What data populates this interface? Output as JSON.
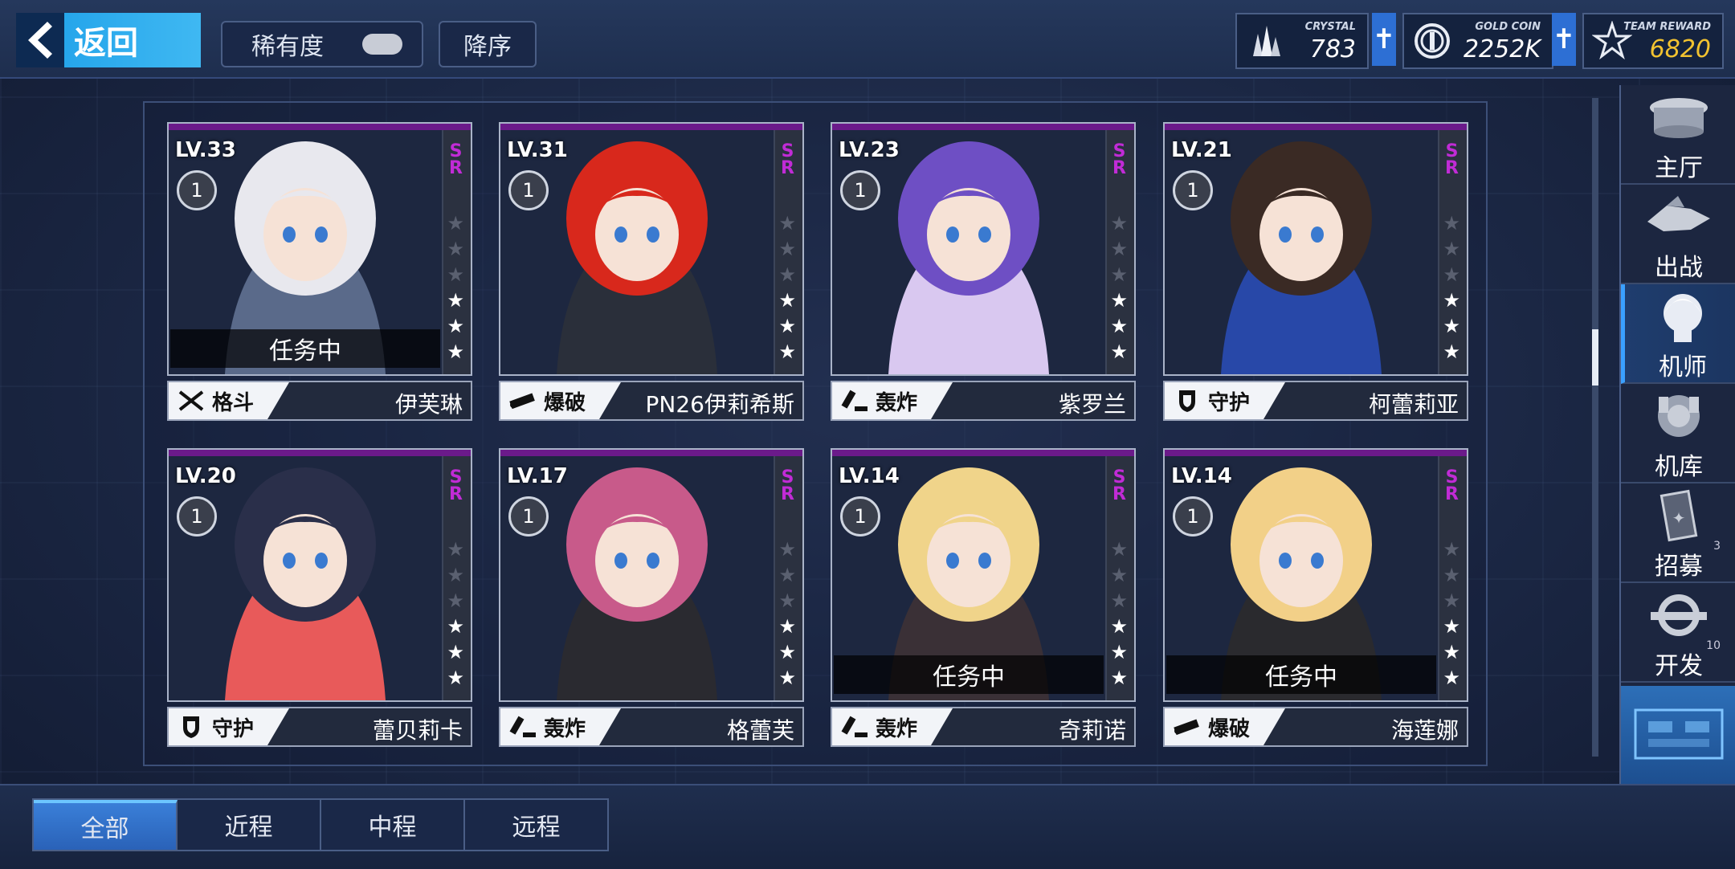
{
  "header": {
    "back_label": "返回",
    "rarity_label": "稀有度",
    "sort_label": "降序"
  },
  "resources": [
    {
      "name": "CRYSTAL",
      "value": "783",
      "icon": "crystal-icon"
    },
    {
      "name": "GOLD COIN",
      "value": "2252K",
      "icon": "gold-coin-icon"
    },
    {
      "name": "TEAM REWARD",
      "value": "6820",
      "icon": "team-reward-icon"
    }
  ],
  "cards": [
    {
      "level": "LV.33",
      "badge": "1",
      "rarity": "SR",
      "stars": 3,
      "mission": "任务中",
      "role": "格斗",
      "name": "伊芙琳",
      "colors": [
        "#e8e8ee",
        "#5a6a8a"
      ]
    },
    {
      "level": "LV.31",
      "badge": "1",
      "rarity": "SR",
      "stars": 3,
      "mission": "",
      "role": "爆破",
      "name": "PN26伊莉希斯",
      "colors": [
        "#d8281c",
        "#2a2f3a"
      ]
    },
    {
      "level": "LV.23",
      "badge": "1",
      "rarity": "SR",
      "stars": 3,
      "mission": "",
      "role": "轰炸",
      "name": "紫罗兰",
      "colors": [
        "#6e4fc4",
        "#d9c8f0"
      ]
    },
    {
      "level": "LV.21",
      "badge": "1",
      "rarity": "SR",
      "stars": 3,
      "mission": "",
      "role": "守护",
      "name": "柯蕾莉亚",
      "colors": [
        "#3a2a24",
        "#2848a8"
      ]
    },
    {
      "level": "LV.20",
      "badge": "1",
      "rarity": "SR",
      "stars": 3,
      "mission": "",
      "role": "守护",
      "name": "蕾贝莉卡",
      "colors": [
        "#2a2f4a",
        "#e85a5a"
      ]
    },
    {
      "level": "LV.17",
      "badge": "1",
      "rarity": "SR",
      "stars": 3,
      "mission": "",
      "role": "轰炸",
      "name": "格蕾芙",
      "colors": [
        "#c85a8a",
        "#2a2a30"
      ]
    },
    {
      "level": "LV.14",
      "badge": "1",
      "rarity": "SR",
      "stars": 3,
      "mission": "任务中",
      "role": "轰炸",
      "name": "奇莉诺",
      "colors": [
        "#f0d48a",
        "#3a3036"
      ]
    },
    {
      "level": "LV.14",
      "badge": "1",
      "rarity": "SR",
      "stars": 3,
      "mission": "任务中",
      "role": "爆破",
      "name": "海莲娜",
      "colors": [
        "#f2d088",
        "#2a2a2e"
      ]
    }
  ],
  "nav": [
    {
      "label": "主厅",
      "icon": "hall-icon",
      "count": ""
    },
    {
      "label": "出战",
      "icon": "sortie-icon",
      "count": ""
    },
    {
      "label": "机师",
      "icon": "pilot-icon",
      "count": "",
      "active": true
    },
    {
      "label": "机库",
      "icon": "hangar-icon",
      "count": ""
    },
    {
      "label": "招募",
      "icon": "recruit-icon",
      "count": "3"
    },
    {
      "label": "开发",
      "icon": "develop-icon",
      "count": "10"
    }
  ],
  "tabs": [
    {
      "label": "全部",
      "active": true
    },
    {
      "label": "近程",
      "active": false
    },
    {
      "label": "中程",
      "active": false
    },
    {
      "label": "远程",
      "active": false
    }
  ],
  "colors": {
    "accent": "#3aa0ff",
    "rarity_sr": "#c12bd6",
    "card_topline": "#6b1a8a"
  }
}
